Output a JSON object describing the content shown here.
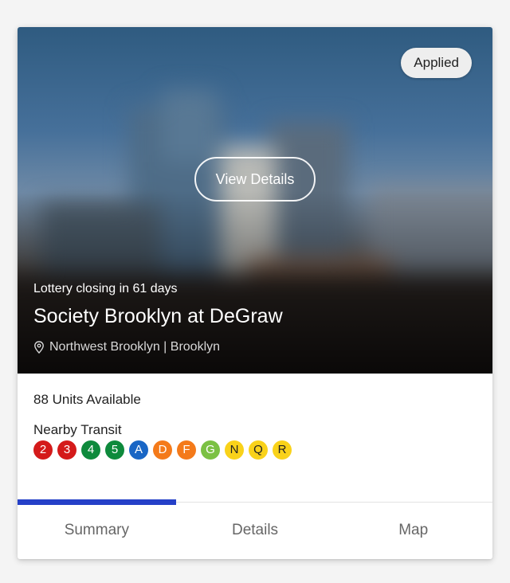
{
  "badge": {
    "label": "Applied"
  },
  "hero": {
    "view_details_label": "View Details",
    "lottery_status": "Lottery closing in 61 days",
    "title": "Society Brooklyn at DeGraw",
    "location": "Northwest Brooklyn | Brooklyn"
  },
  "details": {
    "units_available": "88 Units Available",
    "transit_label": "Nearby Transit"
  },
  "transit_lines": [
    {
      "label": "2",
      "color": "#d41a1a",
      "text_dark": false
    },
    {
      "label": "3",
      "color": "#d41a1a",
      "text_dark": false
    },
    {
      "label": "4",
      "color": "#0e8a3c",
      "text_dark": false
    },
    {
      "label": "5",
      "color": "#0e8a3c",
      "text_dark": false
    },
    {
      "label": "A",
      "color": "#1966c5",
      "text_dark": false
    },
    {
      "label": "D",
      "color": "#f47a1a",
      "text_dark": false
    },
    {
      "label": "F",
      "color": "#f47a1a",
      "text_dark": false
    },
    {
      "label": "G",
      "color": "#7bc143",
      "text_dark": false
    },
    {
      "label": "N",
      "color": "#f9d21a",
      "text_dark": true
    },
    {
      "label": "Q",
      "color": "#f9d21a",
      "text_dark": true
    },
    {
      "label": "R",
      "color": "#f9d21a",
      "text_dark": true
    }
  ],
  "tabs": [
    {
      "label": "Summary",
      "active": true
    },
    {
      "label": "Details",
      "active": false
    },
    {
      "label": "Map",
      "active": false
    }
  ],
  "colors": {
    "tab_indicator": "#2540c8",
    "badge_bg": "#eeeeee"
  },
  "icons": {
    "location": "map-pin-icon"
  }
}
